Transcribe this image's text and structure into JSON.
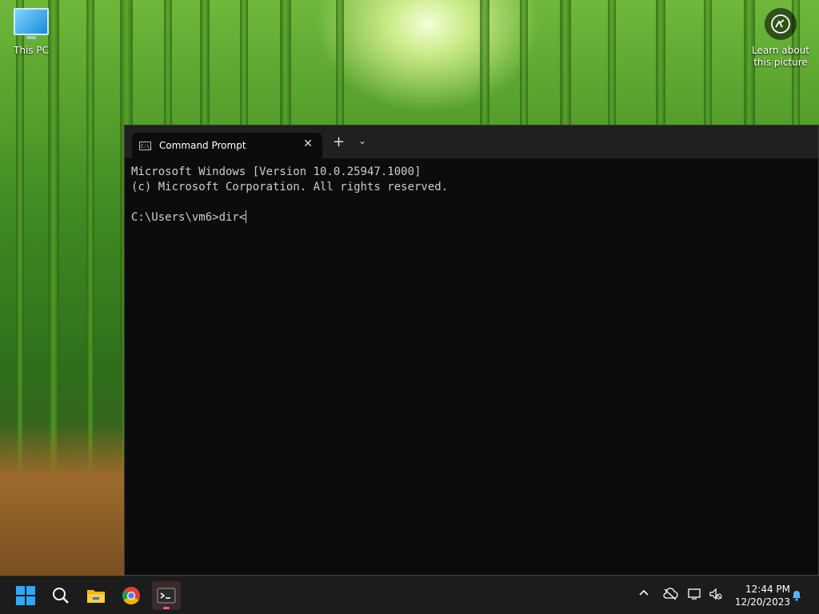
{
  "desktop": {
    "this_pc_label": "This PC",
    "learn_label_line1": "Learn about",
    "learn_label_line2": "this picture"
  },
  "terminal": {
    "tab_title": "Command Prompt",
    "tab_close": "✕",
    "new_tab": "+",
    "dropdown": "⌄",
    "lines": [
      "Microsoft Windows [Version 10.0.25947.1000]",
      "(c) Microsoft Corporation. All rights reserved.",
      "",
      "C:\\Users\\vm6>dir<"
    ]
  },
  "taskbar": {
    "time": "12:44 PM",
    "date": "12/20/2023",
    "icons": [
      "windows-start-icon",
      "search-icon",
      "file-explorer-icon",
      "chrome-icon",
      "terminal-icon"
    ],
    "tray": [
      "chevron-up-icon",
      "cloud-offline-icon",
      "network-icon",
      "volume-muted-icon",
      "notification-bell-icon"
    ]
  },
  "colors": {
    "accent": "#2ea8ff",
    "terminal_bg": "#0c0c0c",
    "taskbar_bg": "#1c1c1c"
  }
}
